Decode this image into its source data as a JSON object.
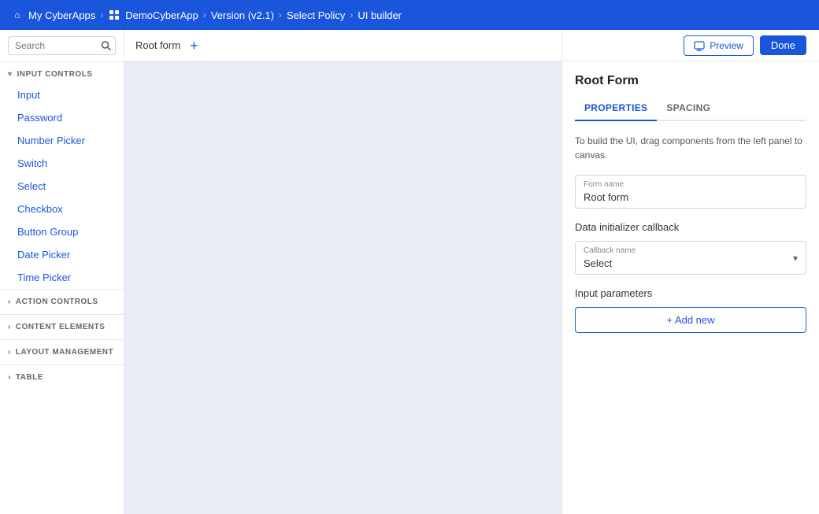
{
  "topbar": {
    "bg_color": "#1a56db",
    "breadcrumbs": [
      {
        "id": "my-cyber-apps",
        "label": "My CyberApps",
        "icon": "home"
      },
      {
        "id": "demo-cyber-app",
        "label": "DemoCyberApp",
        "icon": "grid"
      },
      {
        "id": "version",
        "label": "Version (v2.1)",
        "icon": null
      },
      {
        "id": "select-policy",
        "label": "Select Policy",
        "icon": null
      },
      {
        "id": "ui-builder",
        "label": "UI builder",
        "icon": null
      }
    ]
  },
  "sidebar": {
    "search_placeholder": "Search",
    "sections": [
      {
        "id": "input-controls",
        "label": "INPUT CONTROLS",
        "expanded": true,
        "items": [
          {
            "id": "input",
            "label": "Input"
          },
          {
            "id": "password",
            "label": "Password"
          },
          {
            "id": "number-picker",
            "label": "Number Picker"
          },
          {
            "id": "switch",
            "label": "Switch"
          },
          {
            "id": "select",
            "label": "Select"
          },
          {
            "id": "checkbox",
            "label": "Checkbox"
          },
          {
            "id": "button-group",
            "label": "Button Group"
          },
          {
            "id": "date-picker",
            "label": "Date Picker"
          },
          {
            "id": "time-picker",
            "label": "Time Picker"
          }
        ]
      },
      {
        "id": "action-controls",
        "label": "ACTION CONTROLS",
        "expanded": false,
        "items": []
      },
      {
        "id": "content-elements",
        "label": "CONTENT ELEMENTS",
        "expanded": false,
        "items": []
      },
      {
        "id": "layout-management",
        "label": "LAYOUT MANAGEMENT",
        "expanded": false,
        "items": []
      },
      {
        "id": "table",
        "label": "TABLE",
        "expanded": false,
        "items": []
      }
    ]
  },
  "canvas": {
    "tab_label": "Root form",
    "add_button_label": "+"
  },
  "right_panel": {
    "preview_label": "Preview",
    "done_label": "Done",
    "title": "Root Form",
    "tabs": [
      {
        "id": "properties",
        "label": "PROPERTIES",
        "active": true
      },
      {
        "id": "spacing",
        "label": "SPACING",
        "active": false
      }
    ],
    "hint_text": "To build the UI, drag components from the left panel to canvas.",
    "form_name_label": "Form name",
    "form_name_value": "Root form",
    "data_initializer_label": "Data initializer callback",
    "callback_name_label": "Callback name",
    "callback_name_value": "Select",
    "input_parameters_label": "Input parameters",
    "add_new_label": "+ Add new"
  }
}
